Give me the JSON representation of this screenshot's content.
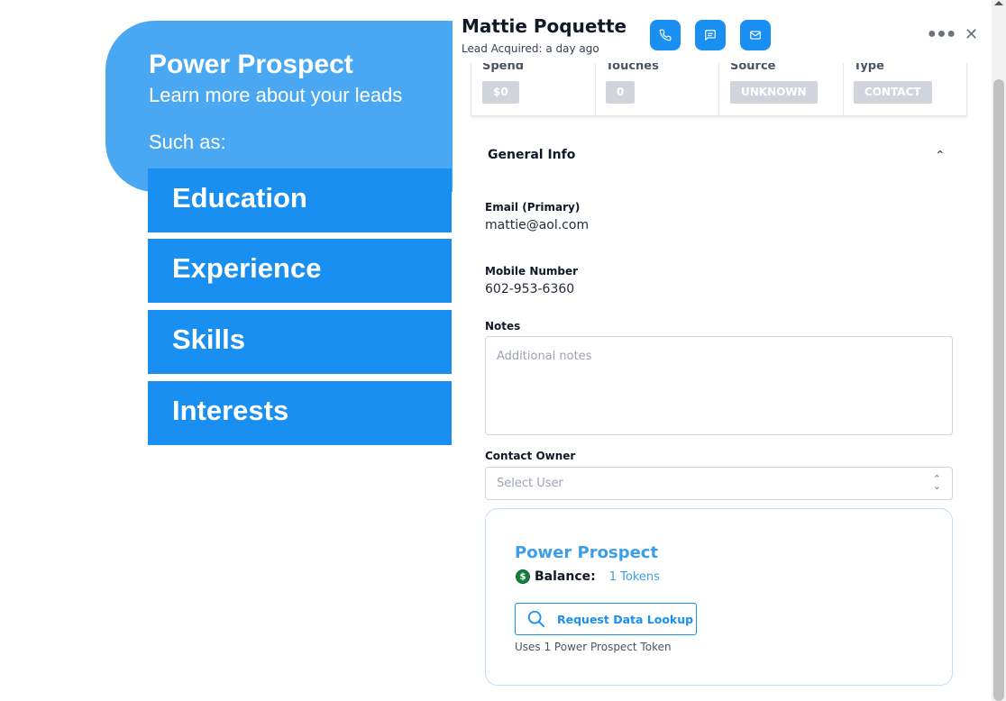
{
  "promo": {
    "title": "Power Prospect",
    "subtitle": "Learn more about your leads",
    "such_as": "Such as:",
    "items": [
      "Education",
      "Experience",
      "Skills",
      "Interests"
    ]
  },
  "lead": {
    "name": "Mattie Poquette",
    "acquired": "Lead Acquired: a day ago",
    "actions": [
      "phone-icon",
      "message-icon",
      "mail-icon"
    ]
  },
  "stats": [
    {
      "label": "Spend",
      "value": "$0"
    },
    {
      "label": "Touches",
      "value": "0"
    },
    {
      "label": "Source",
      "value": "UNKNOWN"
    },
    {
      "label": "Type",
      "value": "CONTACT"
    }
  ],
  "general_info": {
    "title": "General Info",
    "email_label": "Email (Primary)",
    "email": "mattie@aol.com",
    "mobile_label": "Mobile Number",
    "mobile": "602-953-6360",
    "notes_label": "Notes",
    "notes_placeholder": "Additional notes",
    "owner_label": "Contact Owner",
    "owner_placeholder": "Select User"
  },
  "power_prospect": {
    "title": "Power Prospect",
    "balance_label": "Balance:",
    "balance_value": "1 Tokens",
    "button_label": "Request Data Lookup",
    "note": "Uses 1 Power Prospect Token"
  },
  "colors": {
    "accent": "#1a8ff2",
    "promo_light": "#4aa8f2",
    "badge_gray": "#d1d5db",
    "coin_green": "#15803d"
  }
}
